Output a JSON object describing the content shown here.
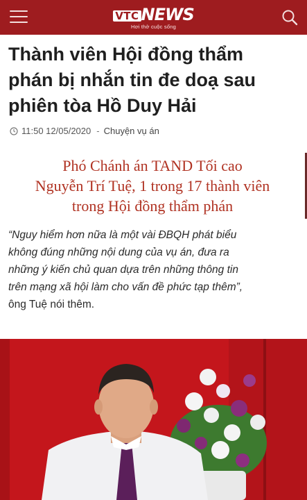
{
  "header": {
    "logo_vtc": "VTC",
    "logo_news": "NEWS",
    "logo_tagline": "Hơi thở cuộc sống",
    "colors": {
      "bar": "#9e1c1f"
    },
    "menu_icon": "hamburger-menu-icon",
    "search_icon": "search-icon"
  },
  "article": {
    "title_lines": [
      "Thành viên Hội đồng thẩm",
      "phán bị nhắn tin đe doạ sau",
      "phiên tòa Hồ Duy Hải"
    ],
    "time": "11:50 12/05/2020",
    "separator": "-",
    "category": "Chuyện vụ án"
  },
  "caption": {
    "lines": [
      "Phó Chánh án TAND Tối cao",
      "Nguyễn Trí Tuệ, 1 trong 17 thành viên",
      "trong Hội đồng thẩm phán"
    ],
    "color": "#b03222"
  },
  "quote": {
    "lines": [
      "“Nguy hiểm hơn nữa là một vài ĐBQH phát biểu",
      "không đúng những nội dung của vụ án, đưa ra",
      "những ý kiến chủ quan dựa trên những thông tin",
      "trên mạng xã hội làm cho vấn đề phức tạp thêm”,"
    ],
    "suffix": "ông Tuệ nói thêm."
  }
}
